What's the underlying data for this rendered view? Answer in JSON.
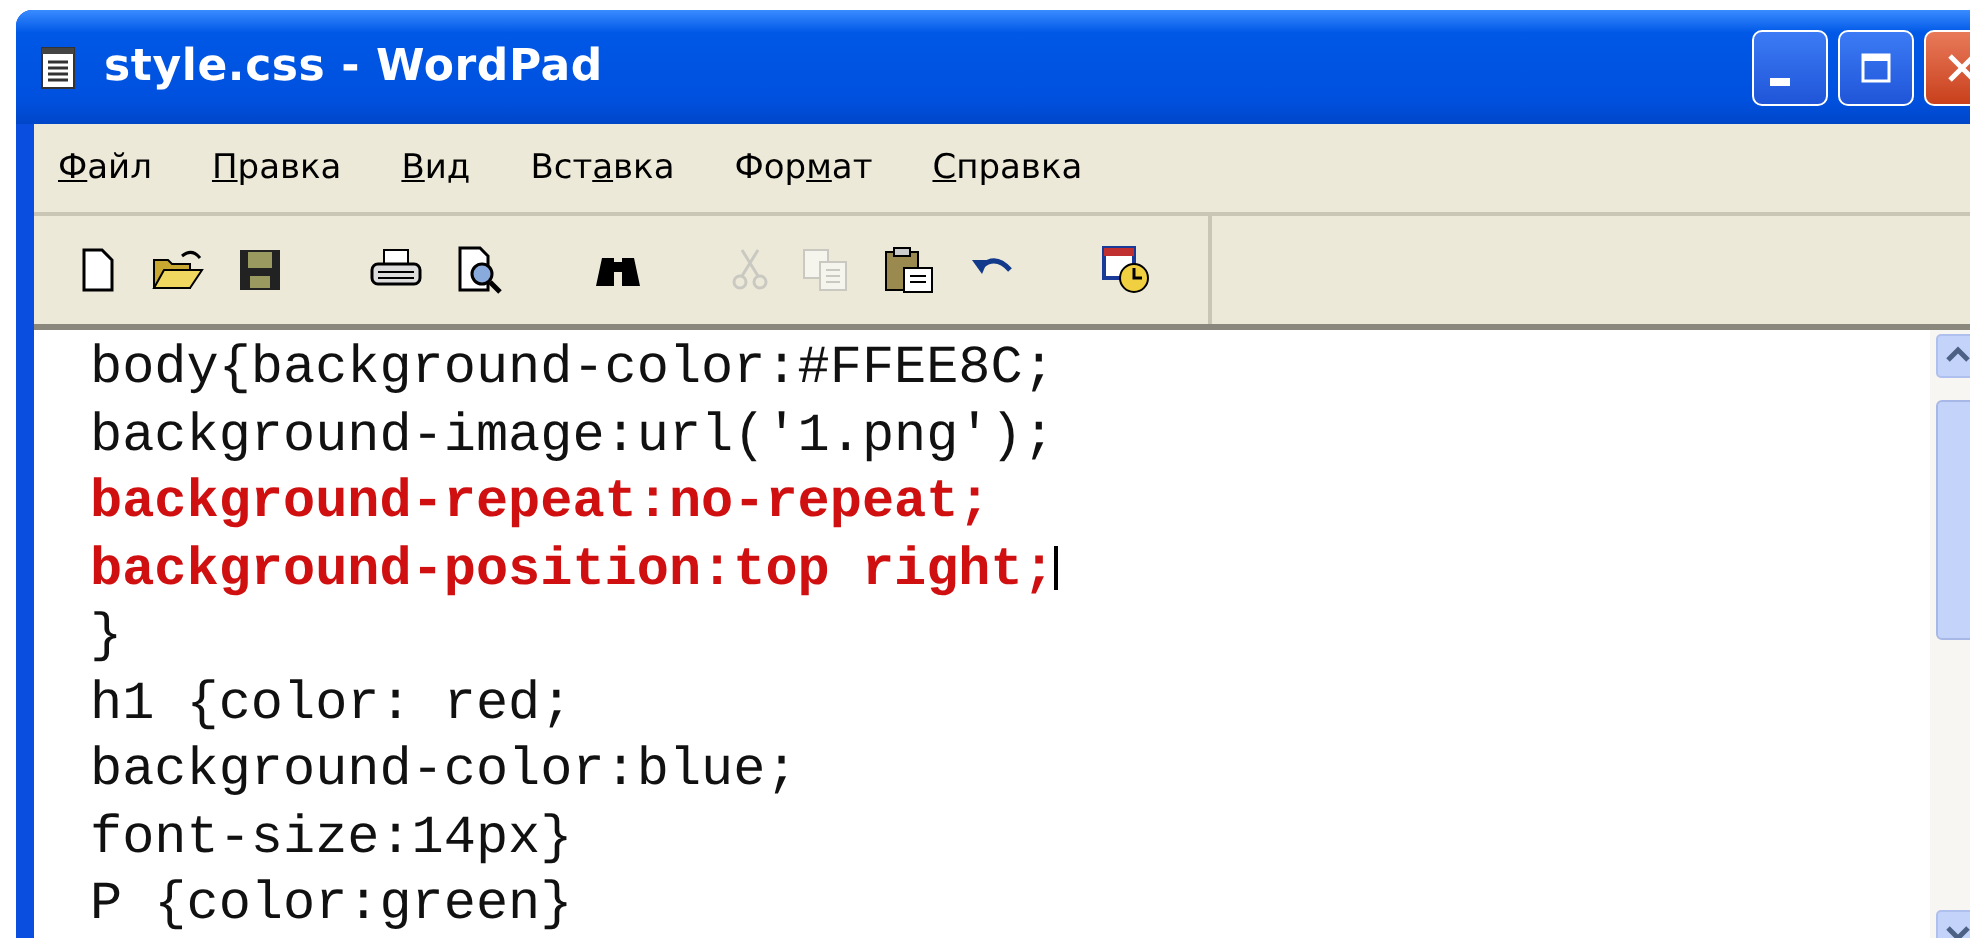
{
  "window": {
    "title": "style.css - WordPad"
  },
  "menu": [
    {
      "key": "Ф",
      "post": "айл"
    },
    {
      "key": "П",
      "post": "равка"
    },
    {
      "key": "В",
      "post": "ид"
    },
    {
      "pre": "Вст",
      "key": "а",
      "post": "вка"
    },
    {
      "pre": "Фор",
      "key": "м",
      "post": "ат"
    },
    {
      "key": "С",
      "post": "правка"
    }
  ],
  "toolbar": [
    {
      "kind": "new",
      "disabled": false
    },
    {
      "kind": "open",
      "disabled": false
    },
    {
      "kind": "save",
      "disabled": false
    },
    {
      "kind": "gap"
    },
    {
      "kind": "print",
      "disabled": false
    },
    {
      "kind": "preview",
      "disabled": false
    },
    {
      "kind": "gap"
    },
    {
      "kind": "find",
      "disabled": false
    },
    {
      "kind": "gap"
    },
    {
      "kind": "cut",
      "disabled": true
    },
    {
      "kind": "copy",
      "disabled": true
    },
    {
      "kind": "paste",
      "disabled": false
    },
    {
      "kind": "undo",
      "disabled": false
    },
    {
      "kind": "gap"
    },
    {
      "kind": "datetime",
      "disabled": false
    }
  ],
  "editor": {
    "lines": [
      {
        "text": "body{background-color:#FFEE8C;",
        "highlighted": false,
        "caret": false
      },
      {
        "text": "background-image:url('1.png');",
        "highlighted": false,
        "caret": false
      },
      {
        "text": "background-repeat:no-repeat;",
        "highlighted": true,
        "caret": false
      },
      {
        "text": "background-position:top right;",
        "highlighted": true,
        "caret": true
      },
      {
        "text": "}",
        "highlighted": false,
        "caret": false
      },
      {
        "text": "h1 {color: red;",
        "highlighted": false,
        "caret": false
      },
      {
        "text": "background-color:blue;",
        "highlighted": false,
        "caret": false
      },
      {
        "text": "font-size:14px}",
        "highlighted": false,
        "caret": false
      },
      {
        "text": "P {color:green}",
        "highlighted": false,
        "caret": false
      }
    ]
  }
}
